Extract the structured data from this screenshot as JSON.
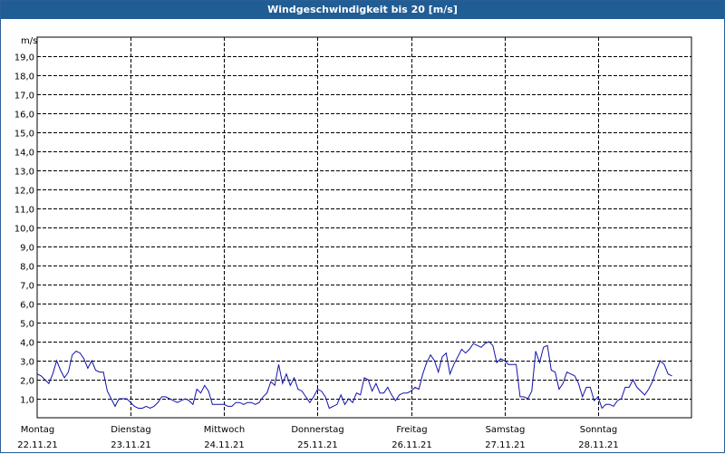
{
  "window": {
    "title": "Windgeschwindigkeit bis 20 [m/s]"
  },
  "colors": {
    "titlebar": "#215d95",
    "series": "#1111aa",
    "grid": "#000000"
  },
  "chart_data": {
    "type": "line",
    "title": "Windgeschwindigkeit bis 20 [m/s]",
    "ylabel": "m/s",
    "ylim": [
      0,
      20
    ],
    "yticks": [
      "1,0",
      "2,0",
      "3,0",
      "4,0",
      "5,0",
      "6,0",
      "7,0",
      "8,0",
      "9,0",
      "10,0",
      "11,0",
      "12,0",
      "13,0",
      "14,0",
      "15,0",
      "16,0",
      "17,0",
      "18,0",
      "19,0"
    ],
    "grid": true,
    "xlim_days": [
      0,
      7
    ],
    "days": [
      {
        "name": "Montag",
        "date": "22.11.21"
      },
      {
        "name": "Dienstag",
        "date": "23.11.21"
      },
      {
        "name": "Mittwoch",
        "date": "24.11.21"
      },
      {
        "name": "Donnerstag",
        "date": "25.11.21"
      },
      {
        "name": "Freitag",
        "date": "26.11.21"
      },
      {
        "name": "Samstag",
        "date": "27.11.21"
      },
      {
        "name": "Sonntag",
        "date": "28.11.21"
      }
    ],
    "series": [
      {
        "points_per_day": 24,
        "values": [
          2.3,
          2.2,
          2.0,
          1.8,
          2.3,
          3.0,
          2.5,
          2.1,
          2.4,
          3.3,
          3.5,
          3.4,
          3.1,
          2.6,
          3.0,
          2.5,
          2.4,
          2.4,
          1.4,
          1.0,
          0.6,
          1.0,
          1.0,
          1.0,
          0.8,
          0.6,
          0.5,
          0.5,
          0.6,
          0.5,
          0.6,
          0.8,
          1.1,
          1.1,
          1.0,
          0.9,
          0.8,
          0.9,
          1.0,
          0.9,
          0.7,
          1.5,
          1.3,
          1.7,
          1.4,
          0.7,
          0.7,
          0.7,
          0.7,
          0.6,
          0.6,
          0.8,
          0.8,
          0.7,
          0.8,
          0.8,
          0.7,
          0.8,
          1.1,
          1.3,
          1.9,
          1.7,
          2.8,
          1.8,
          2.3,
          1.7,
          2.1,
          1.5,
          1.4,
          1.1,
          0.8,
          1.1,
          1.5,
          1.4,
          1.1,
          0.5,
          0.6,
          0.7,
          1.2,
          0.7,
          1.0,
          0.8,
          1.3,
          1.2,
          2.1,
          2.0,
          1.4,
          1.8,
          1.3,
          1.3,
          1.6,
          1.2,
          0.9,
          1.2,
          1.3,
          1.3,
          1.4,
          1.6,
          1.5,
          2.3,
          2.9,
          3.3,
          3.0,
          2.4,
          3.2,
          3.4,
          2.3,
          2.8,
          3.2,
          3.6,
          3.4,
          3.6,
          3.9,
          3.8,
          3.7,
          3.9,
          4.0,
          3.8,
          2.9,
          3.1,
          3.0,
          2.8,
          2.8,
          2.8,
          1.1,
          1.1,
          1.0,
          1.4,
          3.5,
          2.9,
          3.7,
          3.8,
          2.5,
          2.4,
          1.5,
          1.8,
          2.4,
          2.3,
          2.2,
          1.8,
          1.1,
          1.6,
          1.6,
          0.9,
          1.1,
          0.5,
          0.7,
          0.7,
          0.6,
          0.9,
          1.0,
          1.6,
          1.6,
          2.0,
          1.6,
          1.4,
          1.2,
          1.5,
          1.9,
          2.5,
          3.0,
          2.8,
          2.3,
          2.2
        ]
      }
    ]
  }
}
